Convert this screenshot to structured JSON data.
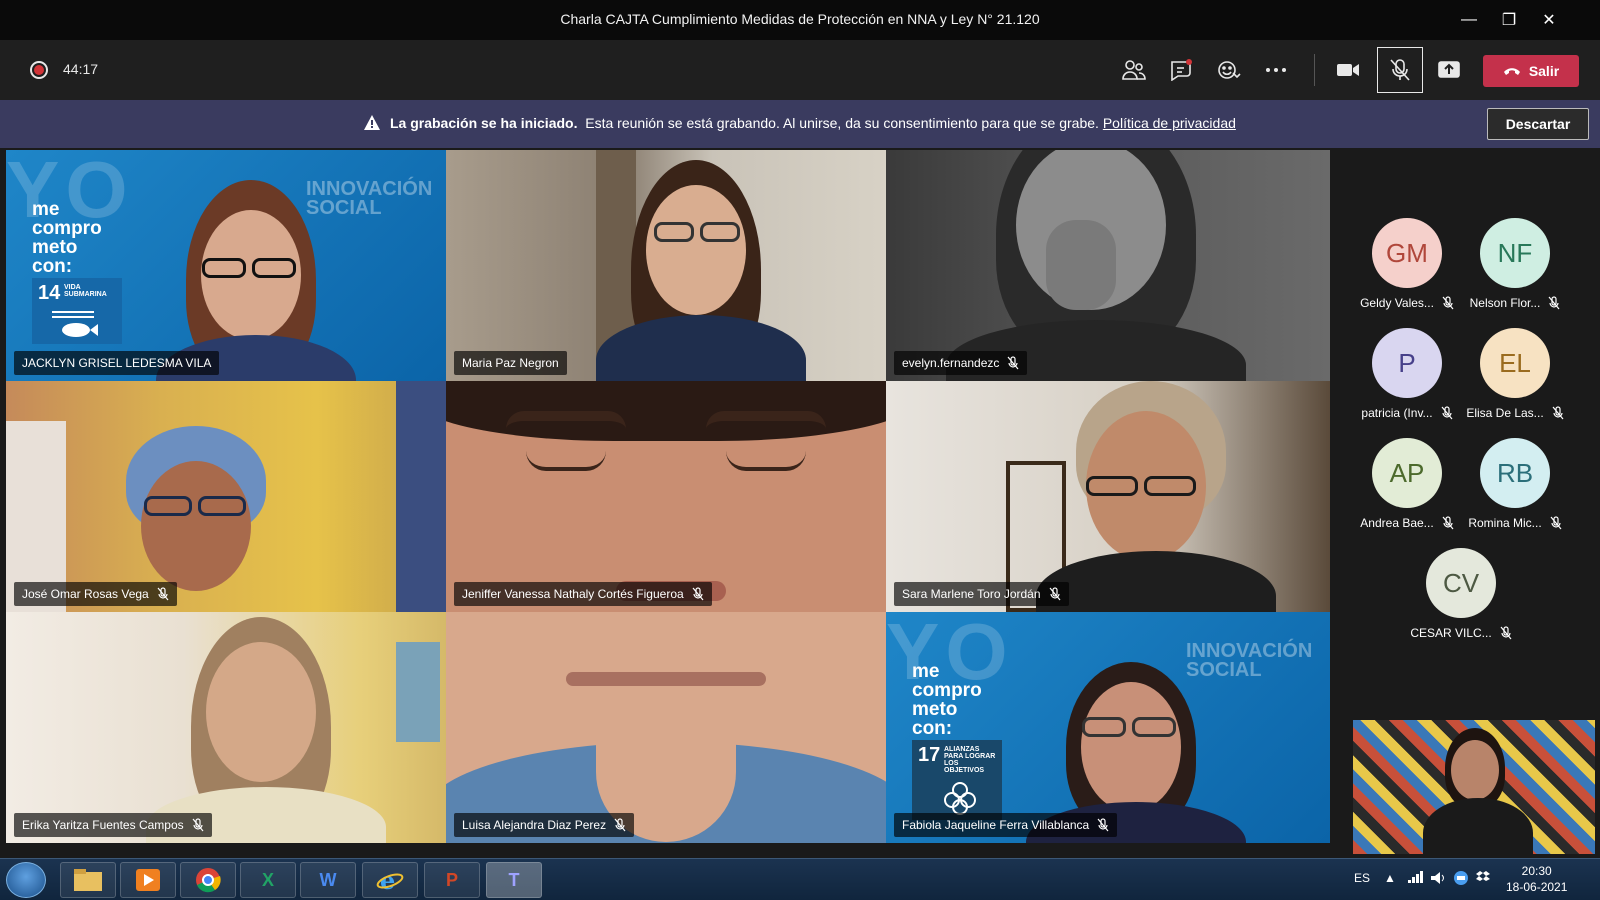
{
  "window": {
    "title": "Charla CAJTA Cumplimiento Medidas de Protección en NNA y Ley N° 21.120",
    "minimize": "—",
    "restore": "❐",
    "close": "✕"
  },
  "toolbar": {
    "timer": "44:17",
    "leave_label": "Salir"
  },
  "banner": {
    "bold_text": "La grabación se ha iniciado.",
    "text": "Esta reunión se está grabando. Al unirse, da su consentimiento para que se grabe.",
    "link": "Política de privacidad",
    "dismiss_label": "Descartar"
  },
  "branding": {
    "yo": "YO",
    "pledge": "me compro meto con:",
    "innovacion": "INNOVACIÓN",
    "social": "SOCIAL",
    "goal1_num": "14",
    "goal1_text": "VIDA SUBMARINA",
    "goal2_num": "17",
    "goal2_text": "ALIANZAS PARA LOGRAR LOS OBJETIVOS"
  },
  "tiles": [
    {
      "name": "JACKLYN GRISEL LEDESMA VILA",
      "muted": false
    },
    {
      "name": "Maria Paz Negron",
      "muted": false
    },
    {
      "name": "evelyn.fernandezc",
      "muted": true
    },
    {
      "name": "José Omar Rosas Vega",
      "muted": true
    },
    {
      "name": "Jeniffer Vanessa Nathaly Cortés Figueroa",
      "muted": true
    },
    {
      "name": "Sara Marlene Toro Jordán",
      "muted": true
    },
    {
      "name": "Erika Yaritza Fuentes Campos",
      "muted": true
    },
    {
      "name": "Luisa Alejandra Diaz Perez",
      "muted": true
    },
    {
      "name": "Fabiola Jaqueline Ferra Villablanca",
      "muted": true
    }
  ],
  "roster": [
    {
      "initials": "GM",
      "name": "Geldy Vales...",
      "bg": "#f5d0cb",
      "fg": "#b0473b"
    },
    {
      "initials": "NF",
      "name": "Nelson Flor...",
      "bg": "#cfeee2",
      "fg": "#287859"
    },
    {
      "initials": "P",
      "name": "patricia (Inv...",
      "bg": "#d9d6f0",
      "fg": "#47408a"
    },
    {
      "initials": "EL",
      "name": "Elisa De Las...",
      "bg": "#f7e2c2",
      "fg": "#9a6b1e"
    },
    {
      "initials": "AP",
      "name": "Andrea Bae...",
      "bg": "#e2ecd6",
      "fg": "#4c6a2c"
    },
    {
      "initials": "RB",
      "name": "Romina Mic...",
      "bg": "#d3eef1",
      "fg": "#2b6f7a"
    },
    {
      "initials": "CV",
      "name": "CESAR VILC...",
      "bg": "#e4e8dc",
      "fg": "#4d5943"
    }
  ],
  "taskbar": {
    "apps": [
      "explorer",
      "media-player",
      "chrome",
      "excel",
      "word",
      "internet-explorer",
      "powerpoint",
      "teams"
    ],
    "excel_label": "X",
    "word_label": "W",
    "ppt_label": "P",
    "teams_label": "T",
    "language": "ES",
    "time": "20:30",
    "date": "18-06-2021"
  },
  "colors": {
    "accent": "#8b8cc7",
    "leave": "#c4314b",
    "banner": "#3a3b5f"
  }
}
